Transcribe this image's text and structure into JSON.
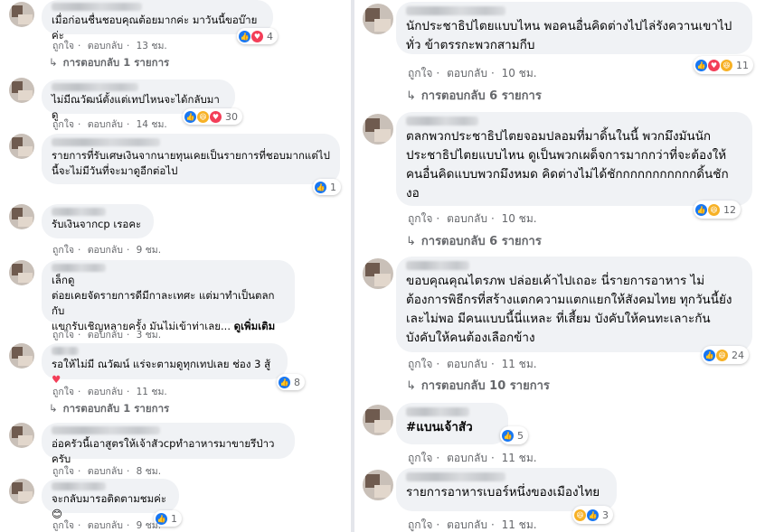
{
  "labels": {
    "like": "ถูกใจ",
    "reply": "ตอบกลับ",
    "dot": "·",
    "reply_arrow": "↳"
  },
  "left": [
    {
      "text": "เมื่อก่อนชื่นชอบคุณต้อยมากค่ะ มาวันนี้ขอบ๊ายค่ะ",
      "reactions": [
        "like",
        "love"
      ],
      "count": "4",
      "time": "13 ชม.",
      "replies": "การตอบกลับ 1 รายการ"
    },
    {
      "text": "ไม่มีณวัฒน์ตั้งแต่เทปไหนจะได้กลับมาดู",
      "reactions": [
        "like",
        "haha",
        "love"
      ],
      "count": "30",
      "time": "14 ชม.",
      "replies": ""
    },
    {
      "text": "รายการที่รับเศษเงินจากนายทุนเคยเป็นรายการที่ชอบมากแต่ไป\nนี้จะไม่มีวันที่จะมาดูอีกต่อไป",
      "reactions": [
        "like"
      ],
      "count": "1",
      "time": "",
      "replies": ""
    },
    {
      "text": "รับเงินจากcp เรอคะ",
      "reactions": [],
      "count": "",
      "time": "9 ชม.",
      "replies": ""
    },
    {
      "text": "เล็กดู\nต่อยเคยจัดรายการดีมีกาละเทศะ แต่มาทำเป็นตลกกับ\nแขกรับเชิญหลายครั้ง มันไม่เข้าท่าเลย...",
      "see_more": "ดูเพิ่มเติม",
      "reactions": [],
      "count": "",
      "time": "3 ชม.",
      "replies": ""
    },
    {
      "text": "รอให้ไม่มี ณวัฒน์ แร่จะตามดูทุกเทปเลย ช่อง 3 สู้",
      "reactions": [
        "like"
      ],
      "count": "8",
      "time": "11 ชม.",
      "replies": "การตอบกลับ 1 รายการ"
    },
    {
      "text": "อ่อครัวนี้เอาสูตรให้เจ้าสัวcpทำอาหารมาขายรึป่าวครับ",
      "reactions": [],
      "count": "",
      "time": "8 ชม.",
      "replies": ""
    },
    {
      "text": "จะกลับมารอติดตามชมค่ะ😊",
      "reactions": [
        "like"
      ],
      "count": "1",
      "time": "9 ชม.",
      "replies": ""
    }
  ],
  "right": [
    {
      "text": "นักประชาธิปไตยแบบไหน พอคนอื่นคิดต่างไปไล่รังควานเขาไป\nทั่ว ข้าตรรกะพวกสามกีบ",
      "reactions": [
        "like",
        "love",
        "haha"
      ],
      "count": "11",
      "time": "10 ชม.",
      "replies": "การตอบกลับ 6 รายการ"
    },
    {
      "text": "ตลกพวกประชาธิปไตยจอมปลอมที่มาดิ้นในนี้ พวกมึงมันนัก\nประชาธิปไตยแบบไหน ดูเป็นพวกเผด็จการมากกว่าที่จะต้องให้\nคนอื่นคิดแบบพวกมึงหมด คิดต่างไม่ได้ชักกกกกกกกกกกดิ้นชัก\nงอ",
      "reactions": [
        "like",
        "haha"
      ],
      "count": "12",
      "time": "10 ชม.",
      "replies": "การตอบกลับ 6 รายการ"
    },
    {
      "text": "ขอบคุณคุณไตรภพ ปล่อยเค้าไปเถอะ นี่รายการอาหาร ไม่\nต้องการพิธีกรที่สร้างแตกความแตกแยกให้สังคมไทย ทุกวันนี้ยัง\nเละไม่พอ มีคนแบบนี้นี่แหละ ที่เสี้ยม บังคับให้คนทะเลาะกัน\nบังคับให้คนต้องเลือกข้าง",
      "reactions": [
        "like",
        "haha"
      ],
      "count": "24",
      "time": "11 ชม.",
      "replies": "การตอบกลับ 10 รายการ"
    },
    {
      "text": "#แบนเจ้าสัว",
      "reactions": [
        "like"
      ],
      "count": "5",
      "time": "11 ชม.",
      "replies": ""
    },
    {
      "text": "รายการอาหารเบอร์หนึ่งของเมืองไทย",
      "reactions": [
        "haha",
        "like"
      ],
      "count": "3",
      "time": "11 ชม.",
      "replies": ""
    }
  ]
}
